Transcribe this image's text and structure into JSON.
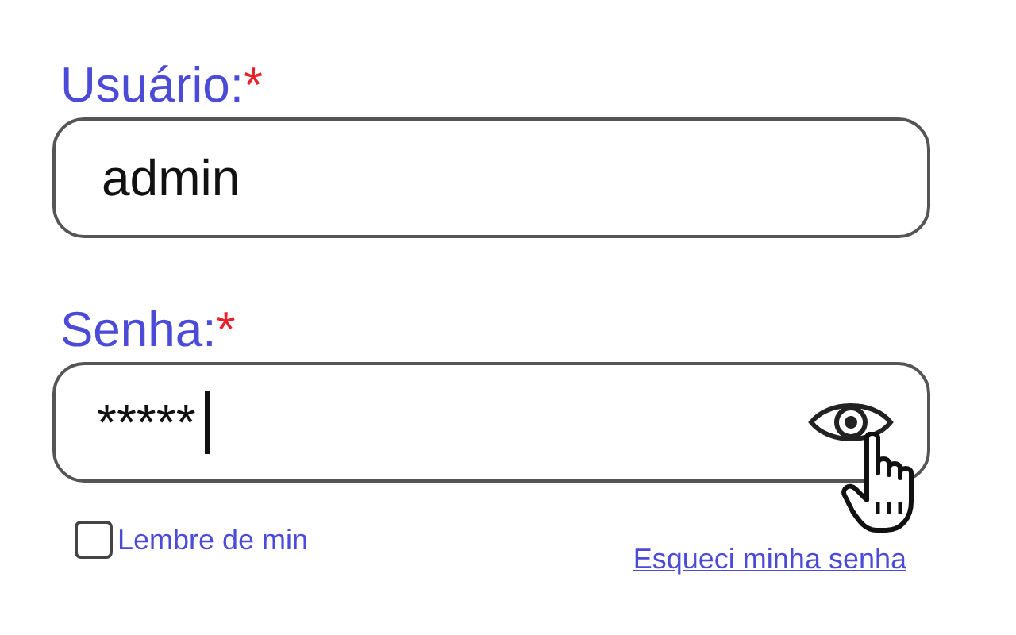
{
  "fields": [
    {
      "kind": "text",
      "label": "Usuário:",
      "required_mark": "*",
      "value": "admin",
      "focused": false
    },
    {
      "kind": "password",
      "label": "Senha:",
      "required_mark": "*",
      "value": "*****",
      "focused": true
    }
  ],
  "remember": {
    "label": "Lembre de min",
    "checked": false
  },
  "forgot_link": "Esqueci minha senha"
}
